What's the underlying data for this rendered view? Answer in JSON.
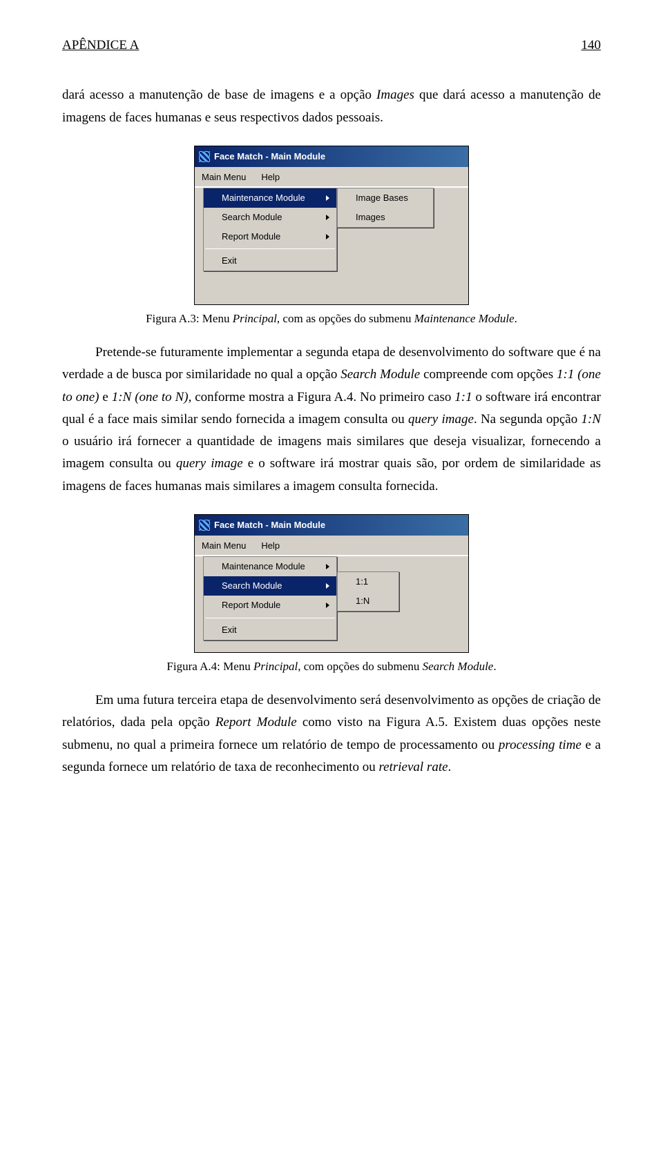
{
  "header": {
    "left": "APÊNDICE A",
    "right": "140"
  },
  "p1_a": "dará acesso a manutenção de base de imagens e a opção ",
  "p1_i1": "Images",
  "p1_b": " que dará acesso a manutenção de imagens de faces humanas e seus respectivos dados pessoais.",
  "cap1_a": "Figura A.3: Menu ",
  "cap1_i1": "Principal",
  "cap1_b": ", com as opções do submenu ",
  "cap1_i2": "Maintenance Module",
  "cap1_c": ".",
  "p2_a": "Pretende-se futuramente implementar a segunda etapa de desenvolvimento do software que é na verdade a de busca por similaridade no qual a opção ",
  "p2_i1": "Search Module",
  "p2_b": " compreende com opções ",
  "p2_i2": "1:1 (one to one)",
  "p2_c": " e ",
  "p2_i3": "1:N (one to N)",
  "p2_d": ", conforme mostra a Figura A.4. No primeiro caso ",
  "p2_i4": "1:1",
  "p2_e": " o software irá encontrar qual é a face mais similar sendo fornecida a imagem consulta ou ",
  "p2_i5": "query image",
  "p2_f": ". Na segunda opção ",
  "p2_i6": "1:N",
  "p2_g": " o usuário irá fornecer a quantidade de imagens mais similares que deseja visualizar, fornecendo a imagem consulta ou ",
  "p2_i7": "query image",
  "p2_h": " e o software irá mostrar quais são, por ordem de similaridade as imagens de faces humanas mais similares a imagem consulta fornecida.",
  "cap2_a": "Figura A.4: Menu ",
  "cap2_i1": "Principal",
  "cap2_b": ", com opções do submenu ",
  "cap2_i2": "Search Module",
  "cap2_c": ".",
  "p3_a": "Em uma futura terceira etapa de desenvolvimento será desenvolvimento as opções de criação de relatórios, dada pela opção ",
  "p3_i1": "Report Module",
  "p3_b": " como visto na Figura A.5. Existem duas opções neste submenu, no qual a primeira fornece um relatório de tempo de processamento ou ",
  "p3_i2": "processing time",
  "p3_c": " e a segunda fornece um relatório de taxa de reconhecimento ou ",
  "p3_i3": "retrieval rate",
  "p3_d": ".",
  "win": {
    "title": "Face Match - Main Module",
    "menubar": {
      "main": "Main Menu",
      "help": "Help"
    },
    "dd": {
      "maintenance": "Maintenance Module",
      "search": "Search Module",
      "report": "Report Module",
      "exit": "Exit"
    },
    "sub1": {
      "image_bases": "Image Bases",
      "images": "Images"
    },
    "sub2": {
      "one_one": "1:1",
      "one_n": "1:N"
    }
  }
}
